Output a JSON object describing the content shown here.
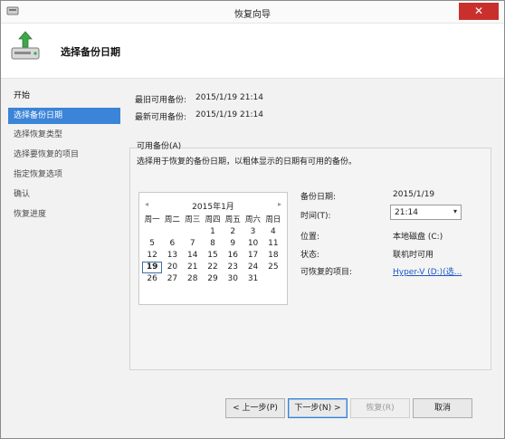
{
  "window": {
    "title": "恢复向导",
    "close_glyph": "✕"
  },
  "header": {
    "page_title": "选择备份日期"
  },
  "nav": {
    "items": [
      {
        "label": "开始"
      },
      {
        "label": "选择备份日期"
      },
      {
        "label": "选择恢复类型"
      },
      {
        "label": "选择要恢复的项目"
      },
      {
        "label": "指定恢复选项"
      },
      {
        "label": "确认"
      },
      {
        "label": "恢复进度"
      }
    ]
  },
  "info": {
    "oldest_label": "最旧可用备份:",
    "oldest_value": "2015/1/19 21:14",
    "newest_label": "最新可用备份:",
    "newest_value": "2015/1/19 21:14"
  },
  "available": {
    "section_label": "可用备份(A)",
    "description": "选择用于恢复的备份日期，以粗体显示的日期有可用的备份。"
  },
  "calendar": {
    "month_title": "2015年1月",
    "prev": "◂",
    "next": "▸",
    "weekdays": [
      "周一",
      "周二",
      "周三",
      "周四",
      "周五",
      "周六",
      "周日"
    ],
    "weeks": [
      [
        "",
        "",
        "",
        "1",
        "2",
        "3",
        "4"
      ],
      [
        "5",
        "6",
        "7",
        "8",
        "9",
        "10",
        "11"
      ],
      [
        "12",
        "13",
        "14",
        "15",
        "16",
        "17",
        "18"
      ],
      [
        "19",
        "20",
        "21",
        "22",
        "23",
        "24",
        "25"
      ],
      [
        "26",
        "27",
        "28",
        "29",
        "30",
        "31",
        ""
      ]
    ],
    "selected_day": "19"
  },
  "details": {
    "backup_date_label": "备份日期:",
    "backup_date_value": "2015/1/19",
    "time_label": "时间(T):",
    "time_value": "21:14",
    "location_label": "位置:",
    "location_value": "本地磁盘 (C:)",
    "status_label": "状态:",
    "status_value": "联机时可用",
    "recoverable_label": "可恢复的项目:",
    "recoverable_value": "Hyper-V (D:)(选..."
  },
  "buttons": {
    "back": "< 上一步(P)",
    "next": "下一步(N) >",
    "recover": "恢复(R)",
    "cancel": "取消"
  },
  "colors": {
    "selection": "#3b84d8",
    "link": "#1d56c4",
    "close": "#c9302c"
  }
}
